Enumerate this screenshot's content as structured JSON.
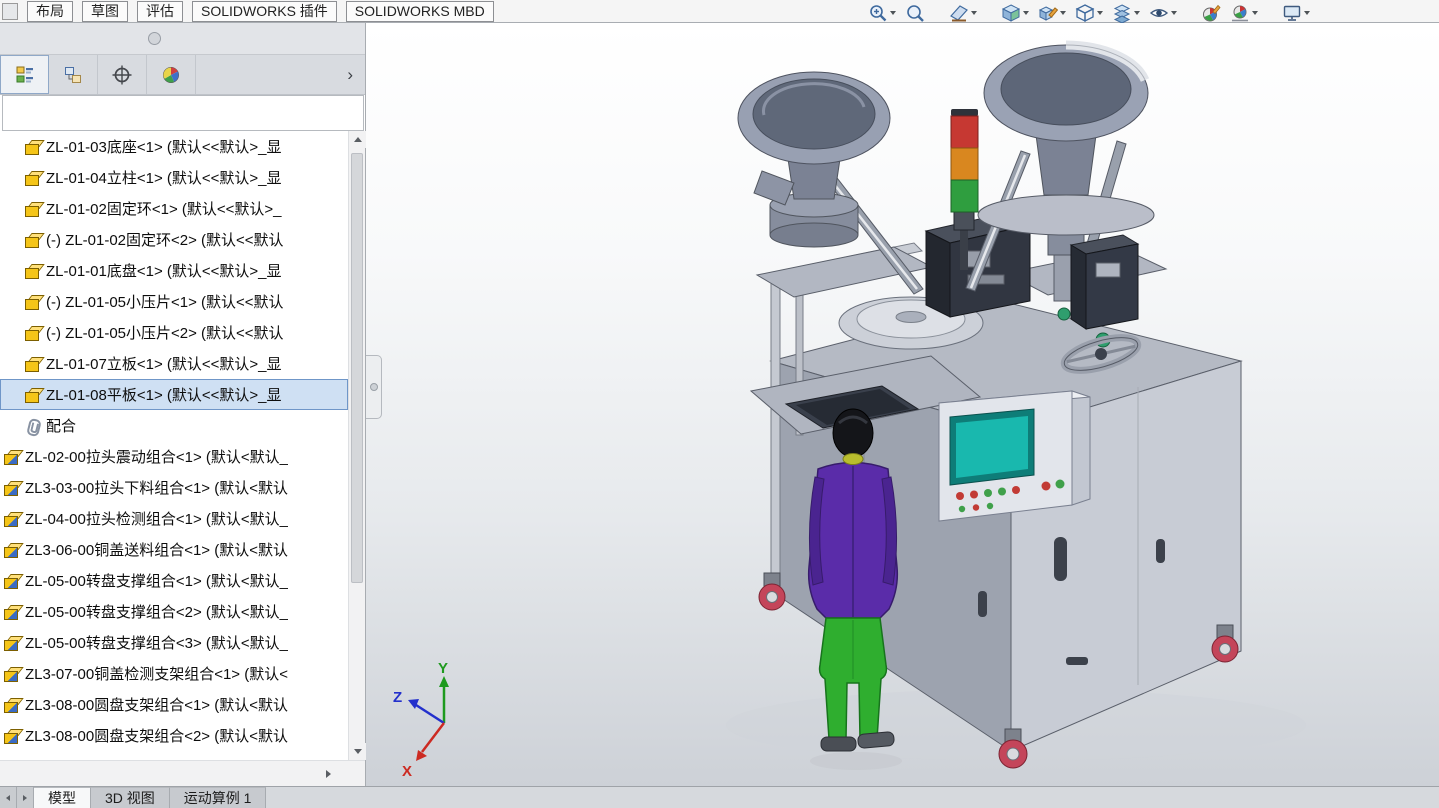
{
  "window": {
    "app_name": "SOLIDWORKS"
  },
  "ribbon": {
    "tabs": [
      {
        "label": "布局"
      },
      {
        "label": "草图"
      },
      {
        "label": "评估"
      },
      {
        "label": "SOLIDWORKS 插件"
      },
      {
        "label": "SOLIDWORKS MBD"
      }
    ]
  },
  "heads_up_toolbar": {
    "icons": [
      "zoom-to-area-icon",
      "zoom-fit-icon",
      "section-view-icon",
      "view-orientation-icon",
      "edit-appearance-icon",
      "display-style-icon",
      "hide-show-items-icon",
      "eye-icon",
      "appearances-icon",
      "apply-scene-icon",
      "view-settings-icon"
    ]
  },
  "feature_panel": {
    "tab_icons": [
      "featuremanager-tree-icon",
      "propertymanager-icon",
      "configurationmanager-icon",
      "displaymanager-icon"
    ],
    "filter_value": "",
    "tree": [
      {
        "icon": "part",
        "indent": 1,
        "label": "ZL-01-03底座<1> (默认<<默认>_显"
      },
      {
        "icon": "part",
        "indent": 1,
        "label": "ZL-01-04立柱<1> (默认<<默认>_显"
      },
      {
        "icon": "part",
        "indent": 1,
        "label": "ZL-01-02固定环<1> (默认<<默认>_"
      },
      {
        "icon": "part",
        "indent": 1,
        "label": "(-) ZL-01-02固定环<2> (默认<<默认"
      },
      {
        "icon": "part",
        "indent": 1,
        "label": "ZL-01-01底盘<1> (默认<<默认>_显"
      },
      {
        "icon": "part",
        "indent": 1,
        "label": "(-) ZL-01-05小压片<1> (默认<<默认"
      },
      {
        "icon": "part",
        "indent": 1,
        "label": "(-) ZL-01-05小压片<2> (默认<<默认"
      },
      {
        "icon": "part",
        "indent": 1,
        "label": "ZL-01-07立板<1> (默认<<默认>_显"
      },
      {
        "icon": "part",
        "indent": 1,
        "selected": true,
        "label": "ZL-01-08平板<1> (默认<<默认>_显"
      },
      {
        "icon": "mates",
        "indent": 1,
        "label": "配合"
      },
      {
        "icon": "assembly",
        "indent": 0,
        "label": "ZL-02-00拉头震动组合<1> (默认<默认_"
      },
      {
        "icon": "assembly",
        "indent": 0,
        "label": "ZL3-03-00拉头下料组合<1> (默认<默认"
      },
      {
        "icon": "assembly",
        "indent": 0,
        "label": "ZL-04-00拉头检测组合<1> (默认<默认_"
      },
      {
        "icon": "assembly",
        "indent": 0,
        "label": "ZL3-06-00铜盖送料组合<1> (默认<默认"
      },
      {
        "icon": "assembly",
        "indent": 0,
        "label": "ZL-05-00转盘支撑组合<1> (默认<默认_"
      },
      {
        "icon": "assembly",
        "indent": 0,
        "label": "ZL-05-00转盘支撑组合<2> (默认<默认_"
      },
      {
        "icon": "assembly",
        "indent": 0,
        "label": "ZL-05-00转盘支撑组合<3> (默认<默认_"
      },
      {
        "icon": "assembly",
        "indent": 0,
        "label": "ZL3-07-00铜盖检测支架组合<1> (默认<"
      },
      {
        "icon": "assembly",
        "indent": 0,
        "label": "ZL3-08-00圆盘支架组合<1> (默认<默认"
      },
      {
        "icon": "assembly",
        "indent": 0,
        "label": "ZL3-08-00圆盘支架组合<2> (默认<默认"
      }
    ]
  },
  "viewport": {
    "triad": {
      "x_label": "X",
      "y_label": "Y",
      "z_label": "Z"
    },
    "colors": {
      "lamp_red": "#c63832",
      "lamp_amber": "#d9871f",
      "lamp_green": "#2f9e3f",
      "mannequin_jacket": "#5a2ca9",
      "mannequin_pants": "#2fae2f",
      "hmi_screen": "#19b8ae",
      "caster_wheel": "#c4455a",
      "selection_highlight": "#cfe0f3"
    }
  },
  "bottom_bar": {
    "tabs": [
      {
        "label": "模型",
        "active": true
      },
      {
        "label": "3D 视图",
        "active": false
      },
      {
        "label": "运动算例 1",
        "active": false
      }
    ]
  }
}
